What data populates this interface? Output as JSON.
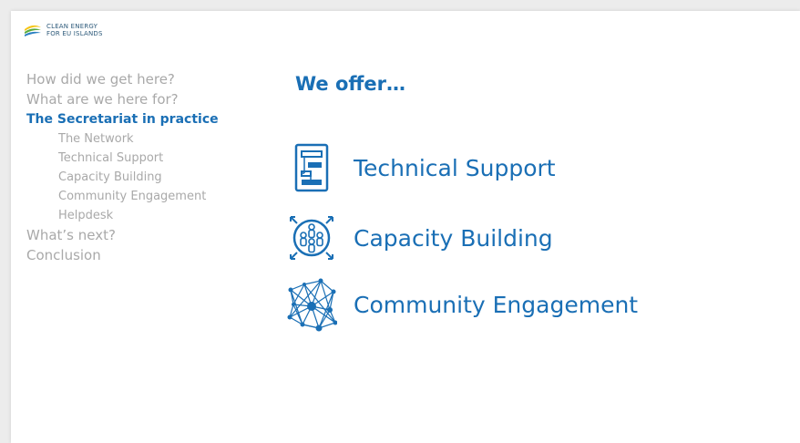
{
  "logo": {
    "line1": "CLEAN ENERGY",
    "line2": "FOR EU ISLANDS"
  },
  "nav": {
    "items": [
      {
        "label": "How did we get here?"
      },
      {
        "label": "What are we here for?"
      },
      {
        "label": "The Secretariat in practice"
      },
      {
        "label": "What’s next?"
      },
      {
        "label": "Conclusion"
      }
    ],
    "sub_items": [
      {
        "label": "The Network"
      },
      {
        "label": "Technical Support"
      },
      {
        "label": "Capacity Building"
      },
      {
        "label": "Community Engagement"
      },
      {
        "label": "Helpdesk"
      }
    ]
  },
  "main": {
    "title": "We offer…",
    "offers": [
      {
        "label": "Technical Support",
        "icon": "flowchart-document-icon"
      },
      {
        "label": "Capacity Building",
        "icon": "people-group-expand-icon"
      },
      {
        "label": "Community Engagement",
        "icon": "network-nodes-icon"
      }
    ]
  },
  "colors": {
    "accent": "#1a6fb5",
    "muted": "#a9a9a9",
    "logo_yellow": "#f5c518",
    "logo_green": "#5aab3c",
    "logo_blue": "#2a7fc1"
  }
}
